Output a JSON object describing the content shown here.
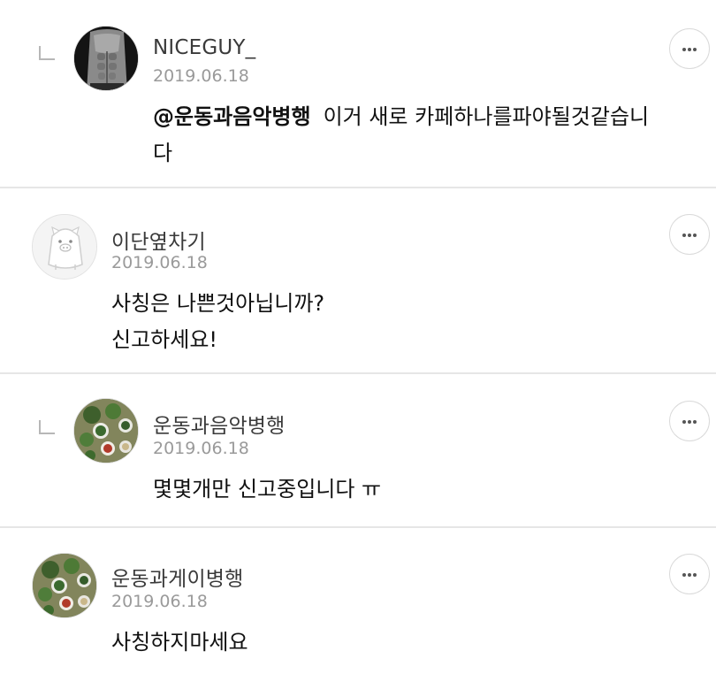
{
  "comments": [
    {
      "author": "NICEGUY_",
      "date": "2019.06.18",
      "mention": "@운동과음악병행",
      "lines": [
        "이거 새로 카페하나를파야될것같습니",
        "다"
      ],
      "avatar": "muscle-torso-photo",
      "is_reply": true
    },
    {
      "author": "이단옆차기",
      "date": "2019.06.18",
      "lines": [
        "사칭은 나쁜것아닙니까?",
        "신고하세요!"
      ],
      "avatar": "default-pig-avatar",
      "is_reply": false
    },
    {
      "author": "운동과음악병행",
      "date": "2019.06.18",
      "lines": [
        "몇몇개만 신고중입니다 ㅠ"
      ],
      "avatar": "food-bowls-photo",
      "is_reply": true
    },
    {
      "author": "운동과게이병행",
      "date": "2019.06.18",
      "lines": [
        "사칭하지마세요"
      ],
      "avatar": "food-bowls-photo",
      "is_reply": false
    }
  ],
  "icons": {
    "reply_indicator": "reply-corner-icon",
    "more_options": "ellipsis-icon"
  },
  "colors": {
    "name": "#3a3a3a",
    "date": "#9a9a9a",
    "divider": "#e6e6e6"
  }
}
